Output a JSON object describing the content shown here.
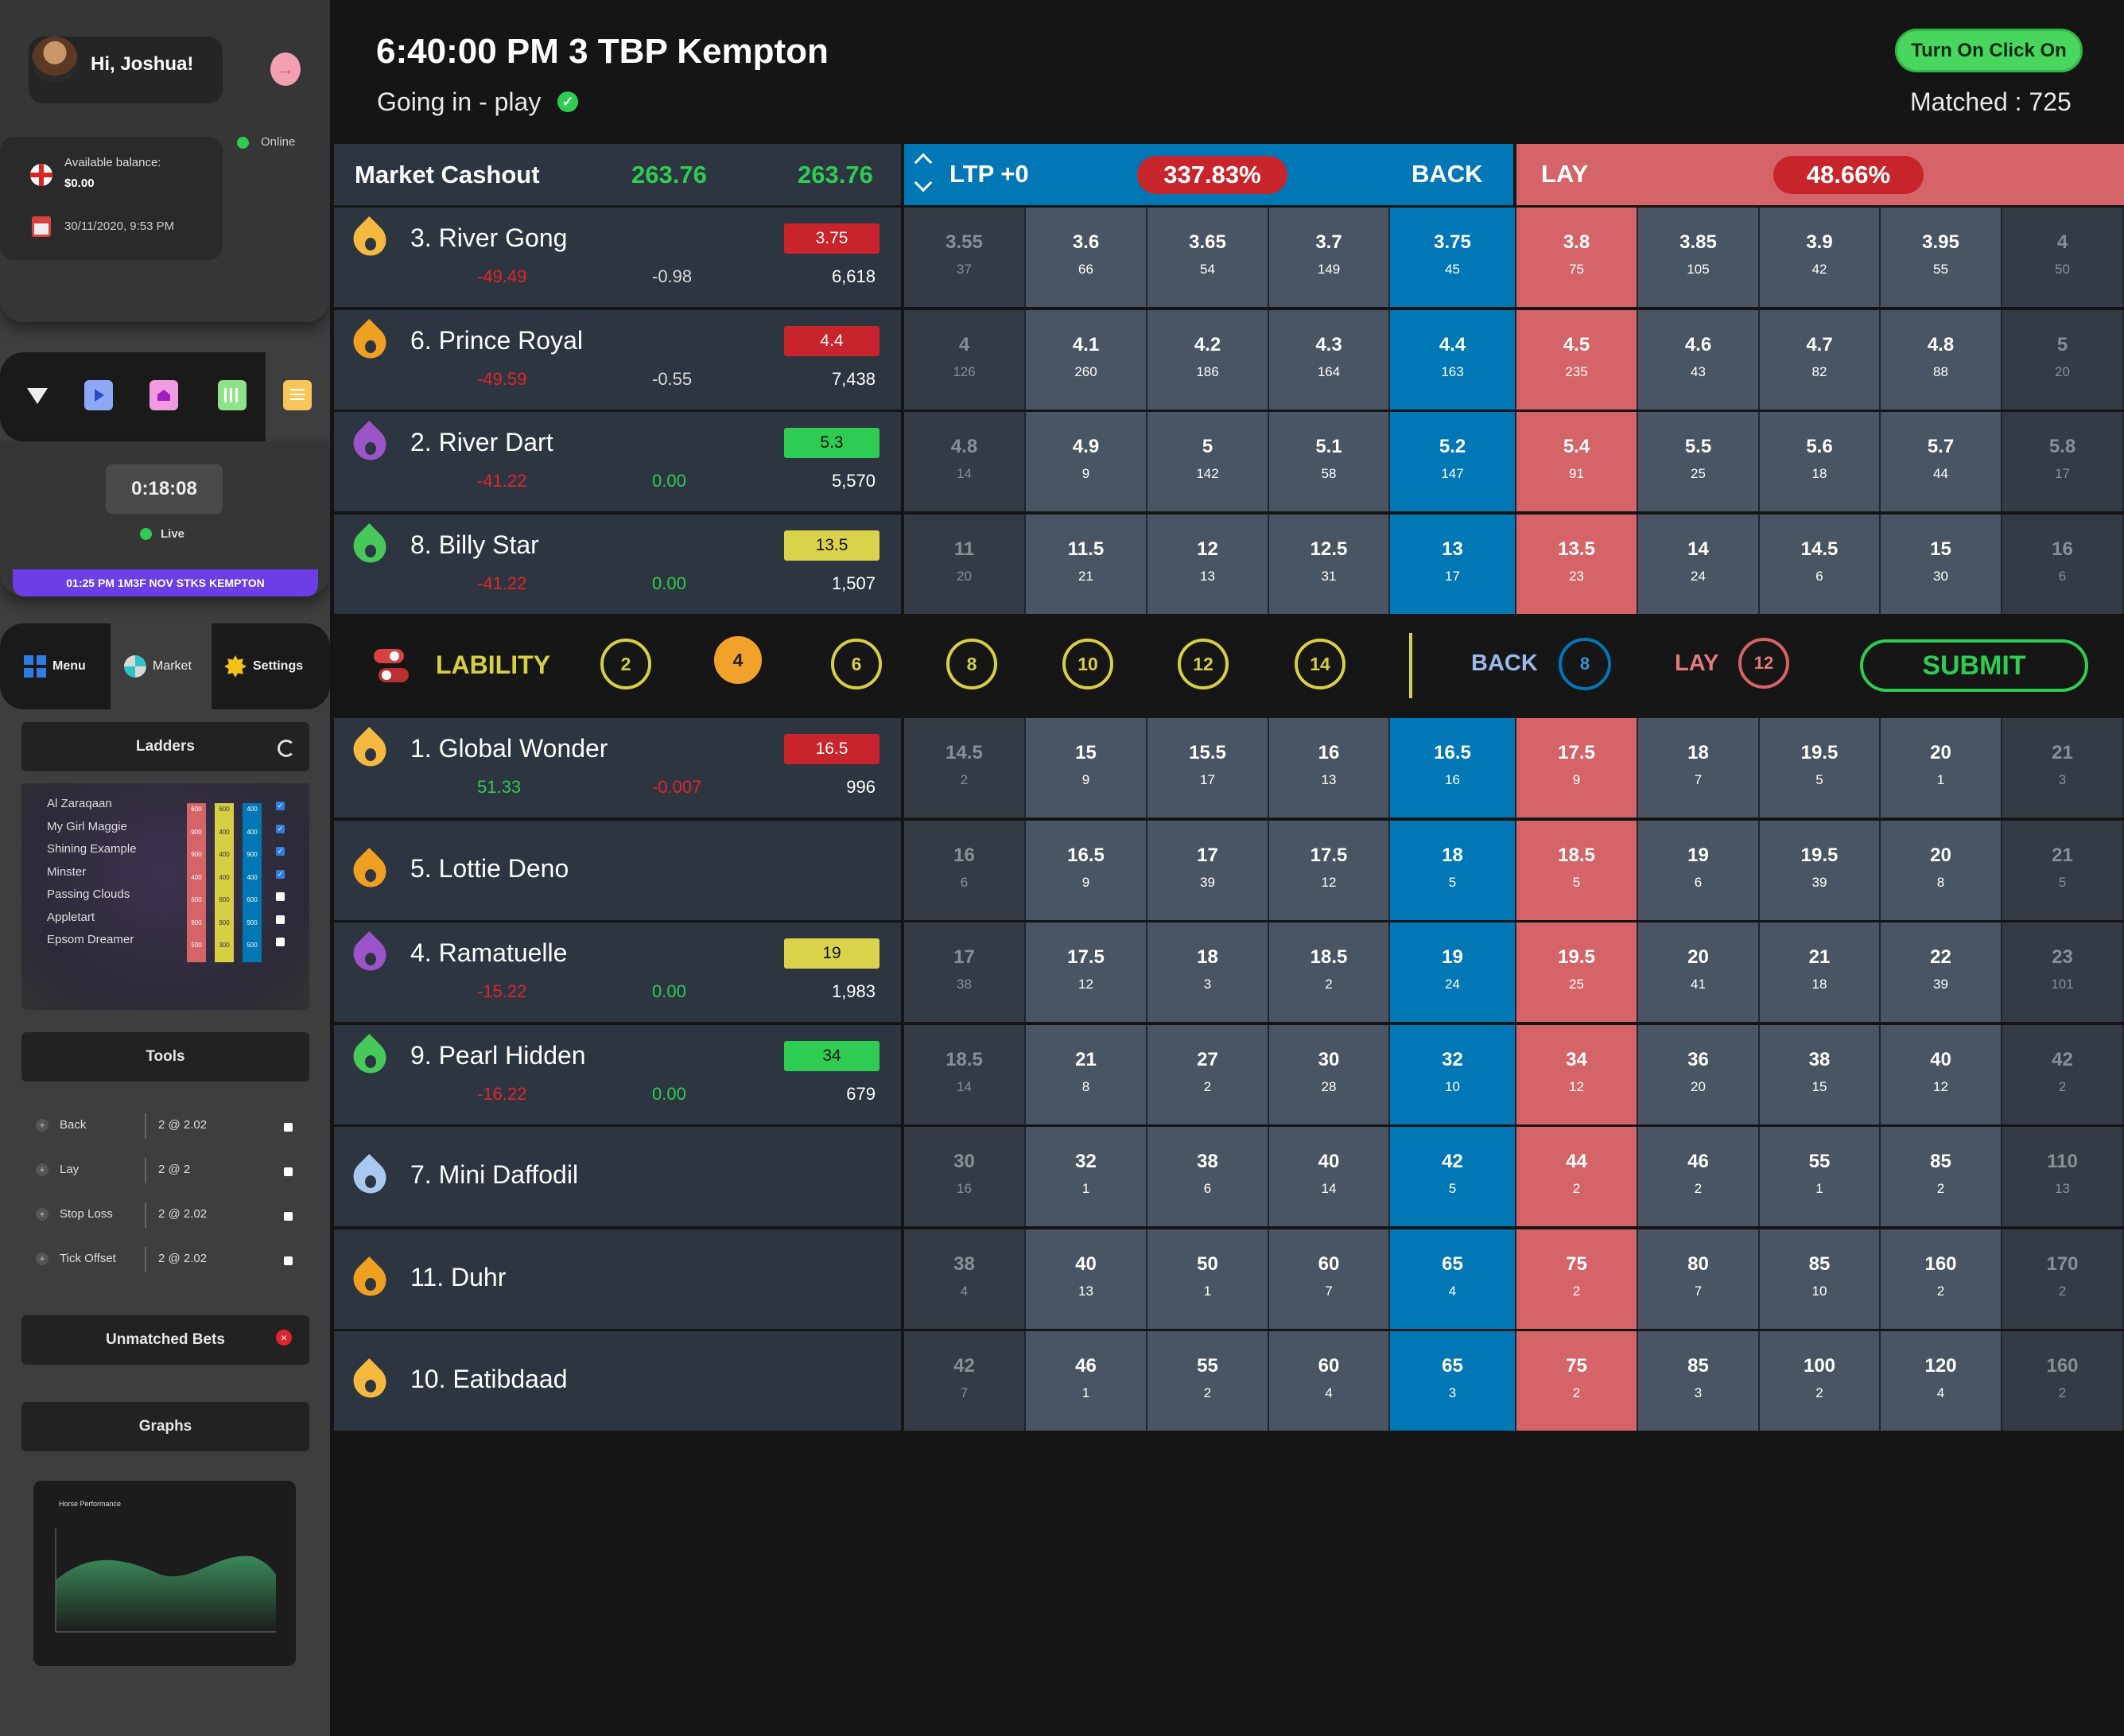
{
  "user": {
    "greeting": "Hi, Joshua!",
    "status": "Online",
    "balance_label": "Available balance:",
    "balance": "$0.00",
    "datetime": "30/11/2020, 9:53 PM"
  },
  "timer": {
    "value": "0:18:08",
    "status": "Live",
    "next_race": "01:25 PM 1M3F NOV STKS KEMPTON"
  },
  "nav": {
    "menu": "Menu",
    "market": "Market",
    "settings": "Settings"
  },
  "ladders": {
    "title": "Ladders",
    "horses": [
      "Al Zaraqaan",
      "My Girl Maggie",
      "Shining Example",
      "Minster",
      "Passing Clouds",
      "Appletart",
      "Epsom Dreamer"
    ],
    "col1": [
      "600",
      "900",
      "900",
      "400",
      "600",
      "900",
      "500"
    ],
    "col2": [
      "600",
      "400",
      "400",
      "400",
      "600",
      "900",
      "300"
    ],
    "col3": [
      "400",
      "400",
      "900",
      "400",
      "600",
      "900",
      "500"
    ],
    "checked": [
      true,
      true,
      true,
      true,
      false,
      false,
      false
    ]
  },
  "tools": {
    "title": "Tools",
    "items": [
      {
        "label": "Back",
        "value": "2 @ 2.02"
      },
      {
        "label": "Lay",
        "value": "2 @ 2"
      },
      {
        "label": "Stop Loss",
        "value": "2 @ 2.02"
      },
      {
        "label": "Tick Offset",
        "value": "2 @ 2.02"
      }
    ]
  },
  "unmatched": {
    "title": "Unmatched Bets"
  },
  "graphs": {
    "title": "Graphs",
    "chart_title": "Horse Performance"
  },
  "header": {
    "title": "6:40:00 PM 3 TBP Kempton",
    "subtitle": "Going in - play",
    "click_btn": "Turn On Click On",
    "matched": "Matched : 725"
  },
  "market": {
    "cashout_label": "Market Cashout",
    "cashout1": "263.76",
    "cashout2": "263.76",
    "ltp": "LTP +0",
    "back_pct": "337.83%",
    "back": "BACK",
    "lay": "LAY",
    "lay_pct": "48.66%"
  },
  "liability": {
    "label": "LABILITY",
    "options": [
      "2",
      "4",
      "6",
      "8",
      "10",
      "12",
      "14"
    ],
    "selected": "4",
    "back_label": "BACK",
    "back_val": "8",
    "lay_label": "LAY",
    "lay_val": "12",
    "submit": "SUBMIT"
  },
  "colors": {
    "back": "#0177b5",
    "lay": "#d56468",
    "green": "#2ecc71",
    "red": "#e0262d",
    "yellow": "#d6cf45",
    "purple": "#6b3ee6"
  },
  "runners_top": [
    {
      "name": "3. River Gong",
      "icon": "#f5b940",
      "pill": "3.75",
      "pillc": "#c7242c",
      "pillt": "#fff",
      "pl": "-49.49",
      "plc": "#e0262d",
      "mid": "-0.98",
      "midc": "#d8d8d8",
      "vol": "6,618",
      "prices": [
        "3.55",
        "3.6",
        "3.65",
        "3.7",
        "3.75",
        "3.8",
        "3.85",
        "3.9",
        "3.95",
        "4"
      ],
      "vols": [
        "37",
        "66",
        "54",
        "149",
        "45",
        "75",
        "105",
        "42",
        "55",
        "50"
      ]
    },
    {
      "name": "6. Prince Royal",
      "icon": "#f0a020",
      "pill": "4.4",
      "pillc": "#c7242c",
      "pillt": "#fff",
      "pl": "-49.59",
      "plc": "#e0262d",
      "mid": "-0.55",
      "midc": "#d8d8d8",
      "vol": "7,438",
      "prices": [
        "4",
        "4.1",
        "4.2",
        "4.3",
        "4.4",
        "4.5",
        "4.6",
        "4.7",
        "4.8",
        "5"
      ],
      "vols": [
        "126",
        "260",
        "186",
        "164",
        "163",
        "235",
        "43",
        "82",
        "88",
        "20"
      ]
    },
    {
      "name": "2. River Dart",
      "icon": "#9b55c8",
      "pill": "5.3",
      "pillc": "#2ecc52",
      "pillt": "#111",
      "pl": "-41.22",
      "plc": "#e0262d",
      "mid": "0.00",
      "midc": "#2ecc52",
      "vol": "5,570",
      "prices": [
        "4.8",
        "4.9",
        "5",
        "5.1",
        "5.2",
        "5.4",
        "5.5",
        "5.6",
        "5.7",
        "5.8"
      ],
      "vols": [
        "14",
        "9",
        "142",
        "58",
        "147",
        "91",
        "25",
        "18",
        "44",
        "17"
      ]
    },
    {
      "name": "8. Billy Star",
      "icon": "#47c85a",
      "pill": "13.5",
      "pillc": "#d9d24a",
      "pillt": "#111",
      "pl": "-41.22",
      "plc": "#e0262d",
      "mid": "0.00",
      "midc": "#2ecc52",
      "vol": "1,507",
      "prices": [
        "11",
        "11.5",
        "12",
        "12.5",
        "13",
        "13.5",
        "14",
        "14.5",
        "15",
        "16"
      ],
      "vols": [
        "20",
        "21",
        "13",
        "31",
        "17",
        "23",
        "24",
        "6",
        "30",
        "6"
      ]
    }
  ],
  "runners_bottom": [
    {
      "name": "1. Global Wonder",
      "icon": "#f5b940",
      "pill": "16.5",
      "pillc": "#c7242c",
      "pillt": "#fff",
      "pl": "51.33",
      "plc": "#2ecc52",
      "mid": "-0.007",
      "midc": "#e0262d",
      "vol": "996",
      "prices": [
        "14.5",
        "15",
        "15.5",
        "16",
        "16.5",
        "17.5",
        "18",
        "19.5",
        "20",
        "21"
      ],
      "vols": [
        "2",
        "9",
        "17",
        "13",
        "16",
        "9",
        "7",
        "5",
        "1",
        "3"
      ]
    },
    {
      "name": "5. Lottie Deno",
      "icon": "#f0a020",
      "pill": "",
      "pillc": "",
      "pillt": "",
      "pl": "",
      "plc": "",
      "mid": "",
      "midc": "",
      "vol": "",
      "prices": [
        "16",
        "16.5",
        "17",
        "17.5",
        "18",
        "18.5",
        "19",
        "19.5",
        "20",
        "21"
      ],
      "vols": [
        "6",
        "9",
        "39",
        "12",
        "5",
        "5",
        "6",
        "39",
        "8",
        "5"
      ]
    },
    {
      "name": "4. Ramatuelle",
      "icon": "#9b55c8",
      "pill": "19",
      "pillc": "#d9d24a",
      "pillt": "#111",
      "pl": "-15.22",
      "plc": "#e0262d",
      "mid": "0.00",
      "midc": "#2ecc52",
      "vol": "1,983",
      "prices": [
        "17",
        "17.5",
        "18",
        "18.5",
        "19",
        "19.5",
        "20",
        "21",
        "22",
        "23"
      ],
      "vols": [
        "38",
        "12",
        "3",
        "2",
        "24",
        "25",
        "41",
        "18",
        "39",
        "101"
      ]
    },
    {
      "name": "9. Pearl Hidden",
      "icon": "#47c85a",
      "pill": "34",
      "pillc": "#2ecc52",
      "pillt": "#111",
      "pl": "-16.22",
      "plc": "#e0262d",
      "mid": "0.00",
      "midc": "#2ecc52",
      "vol": "679",
      "prices": [
        "18.5",
        "21",
        "27",
        "30",
        "32",
        "34",
        "36",
        "38",
        "40",
        "42"
      ],
      "vols": [
        "14",
        "8",
        "2",
        "28",
        "10",
        "12",
        "20",
        "15",
        "12",
        "2"
      ]
    },
    {
      "name": "7. Mini Daffodil",
      "icon": "#a8c8f0",
      "pill": "",
      "pillc": "",
      "pillt": "",
      "pl": "",
      "plc": "",
      "mid": "",
      "midc": "",
      "vol": "",
      "prices": [
        "30",
        "32",
        "38",
        "40",
        "42",
        "44",
        "46",
        "55",
        "85",
        "110"
      ],
      "vols": [
        "16",
        "1",
        "6",
        "14",
        "5",
        "2",
        "2",
        "1",
        "2",
        "13"
      ]
    },
    {
      "name": "11. Duhr",
      "icon": "#f0a020",
      "pill": "",
      "pillc": "",
      "pillt": "",
      "pl": "",
      "plc": "",
      "mid": "",
      "midc": "",
      "vol": "",
      "prices": [
        "38",
        "40",
        "50",
        "60",
        "65",
        "75",
        "80",
        "85",
        "160",
        "170"
      ],
      "vols": [
        "4",
        "13",
        "1",
        "7",
        "4",
        "2",
        "7",
        "10",
        "2",
        "2"
      ]
    },
    {
      "name": "10. Eatibdaad",
      "icon": "#f5b940",
      "pill": "",
      "pillc": "",
      "pillt": "",
      "pl": "",
      "plc": "",
      "mid": "",
      "midc": "",
      "vol": "",
      "prices": [
        "42",
        "46",
        "55",
        "60",
        "65",
        "75",
        "85",
        "100",
        "120",
        "160"
      ],
      "vols": [
        "7",
        "1",
        "2",
        "4",
        "3",
        "2",
        "3",
        "2",
        "4",
        "2"
      ]
    }
  ]
}
